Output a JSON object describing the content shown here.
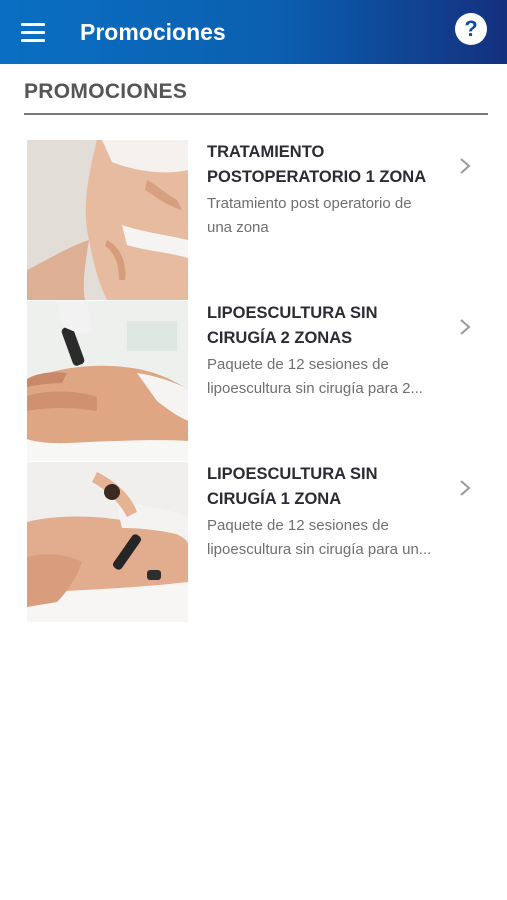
{
  "header": {
    "title": "Promociones",
    "menu_icon": "menu-icon",
    "help_icon": "help-icon",
    "help_glyph": "?",
    "gradient_start": "#0a6fc2",
    "gradient_end": "#14307e"
  },
  "section": {
    "title": "PROMOCIONES"
  },
  "promotions": [
    {
      "title": "TRATAMIENTO POSTOPERATORIO 1 ZONA",
      "description_lines": [
        "Tratamiento post operatorio de",
        "una zona"
      ],
      "image": "body-contour-photo",
      "chevron_icon": "chevron-right-icon"
    },
    {
      "title": "LIPOESCULTURA SIN CIRUGÍA 2 ZONAS",
      "description_lines": [
        "Paquete de 12 sesiones de",
        "lipoescultura sin cirugía para 2..."
      ],
      "image": "lipo-treatment-photo",
      "chevron_icon": "chevron-right-icon"
    },
    {
      "title": "LIPOESCULTURA SIN CIRUGÍA 1 ZONA",
      "description_lines": [
        "Paquete de 12 sesiones de",
        "lipoescultura sin cirugía para un..."
      ],
      "image": "massage-treatment-photo",
      "chevron_icon": "chevron-right-icon"
    }
  ]
}
